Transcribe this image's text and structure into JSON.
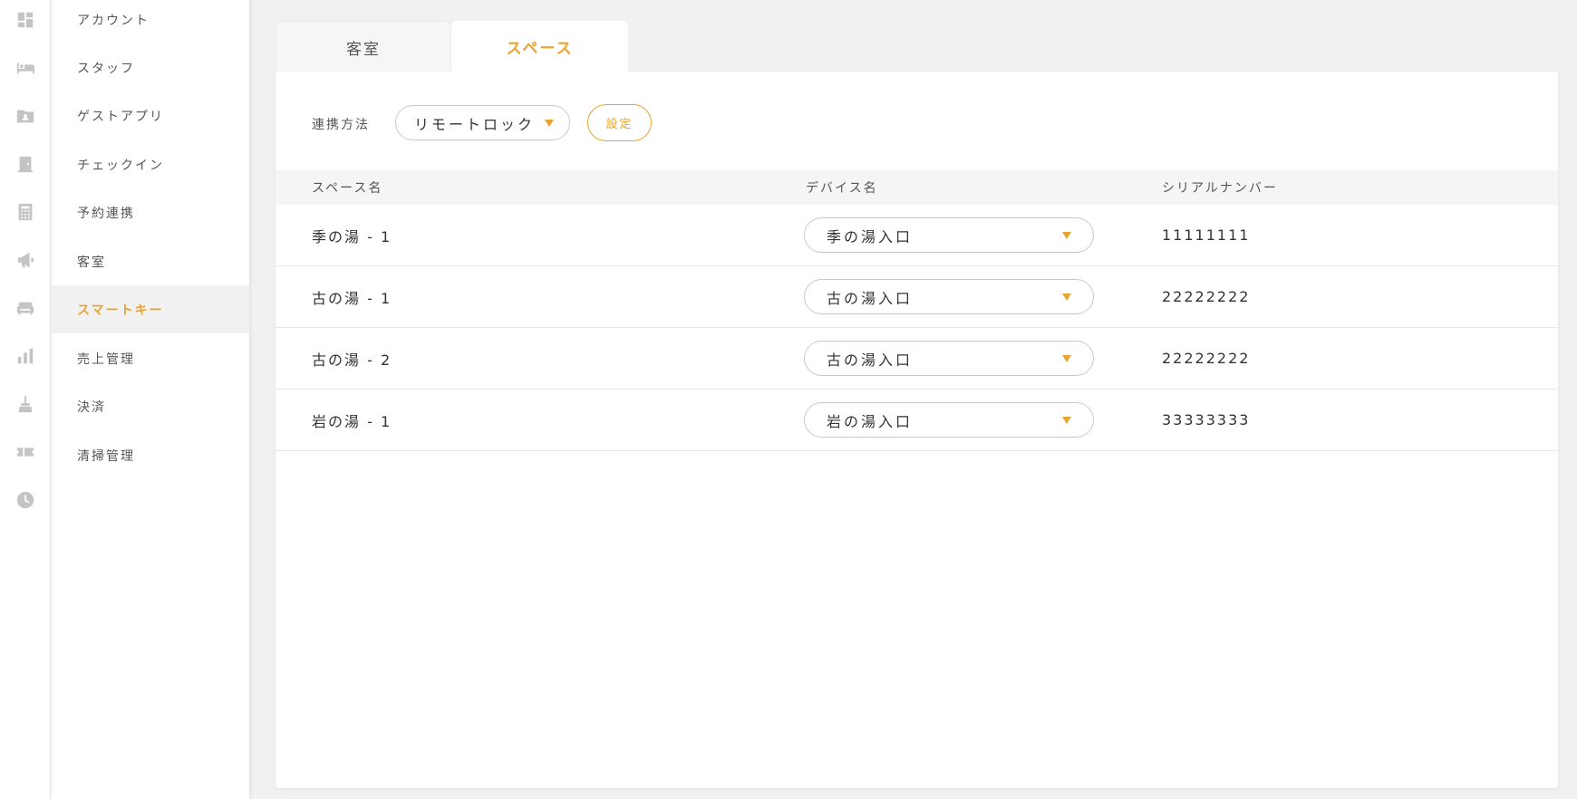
{
  "rail_icons": [
    "dashboard-icon",
    "bed-icon",
    "contact-folder-icon",
    "door-icon",
    "calculator-icon",
    "megaphone-icon",
    "armchair-icon",
    "bar-chart-icon",
    "broom-icon",
    "ticket-icon",
    "clock-icon"
  ],
  "sidebar": {
    "items": [
      {
        "label": "アカウント"
      },
      {
        "label": "スタッフ"
      },
      {
        "label": "ゲストアプリ"
      },
      {
        "label": "チェックイン"
      },
      {
        "label": "予約連携"
      },
      {
        "label": "客室"
      },
      {
        "label": "スマートキー",
        "active": true
      },
      {
        "label": "売上管理"
      },
      {
        "label": "決済"
      },
      {
        "label": "清掃管理"
      }
    ]
  },
  "tabs": [
    {
      "label": "客室",
      "active": false
    },
    {
      "label": "スペース",
      "active": true
    }
  ],
  "panel": {
    "link_method_label": "連携方法",
    "link_method_value": "リモートロック",
    "set_button_label": "設定"
  },
  "table": {
    "headers": [
      "スペース名",
      "デバイス名",
      "シリアルナンバー"
    ],
    "rows": [
      {
        "space": "季の湯 - 1",
        "device": "季の湯入口",
        "serial": "11111111"
      },
      {
        "space": "古の湯 - 1",
        "device": "古の湯入口",
        "serial": "22222222"
      },
      {
        "space": "古の湯 - 2",
        "device": "古の湯入口",
        "serial": "22222222"
      },
      {
        "space": "岩の湯 - 1",
        "device": "岩の湯入口",
        "serial": "33333333"
      }
    ]
  },
  "colors": {
    "accent": "#e8a431",
    "icon_gray": "#c4c4c4",
    "background": "#f1f1f1"
  }
}
